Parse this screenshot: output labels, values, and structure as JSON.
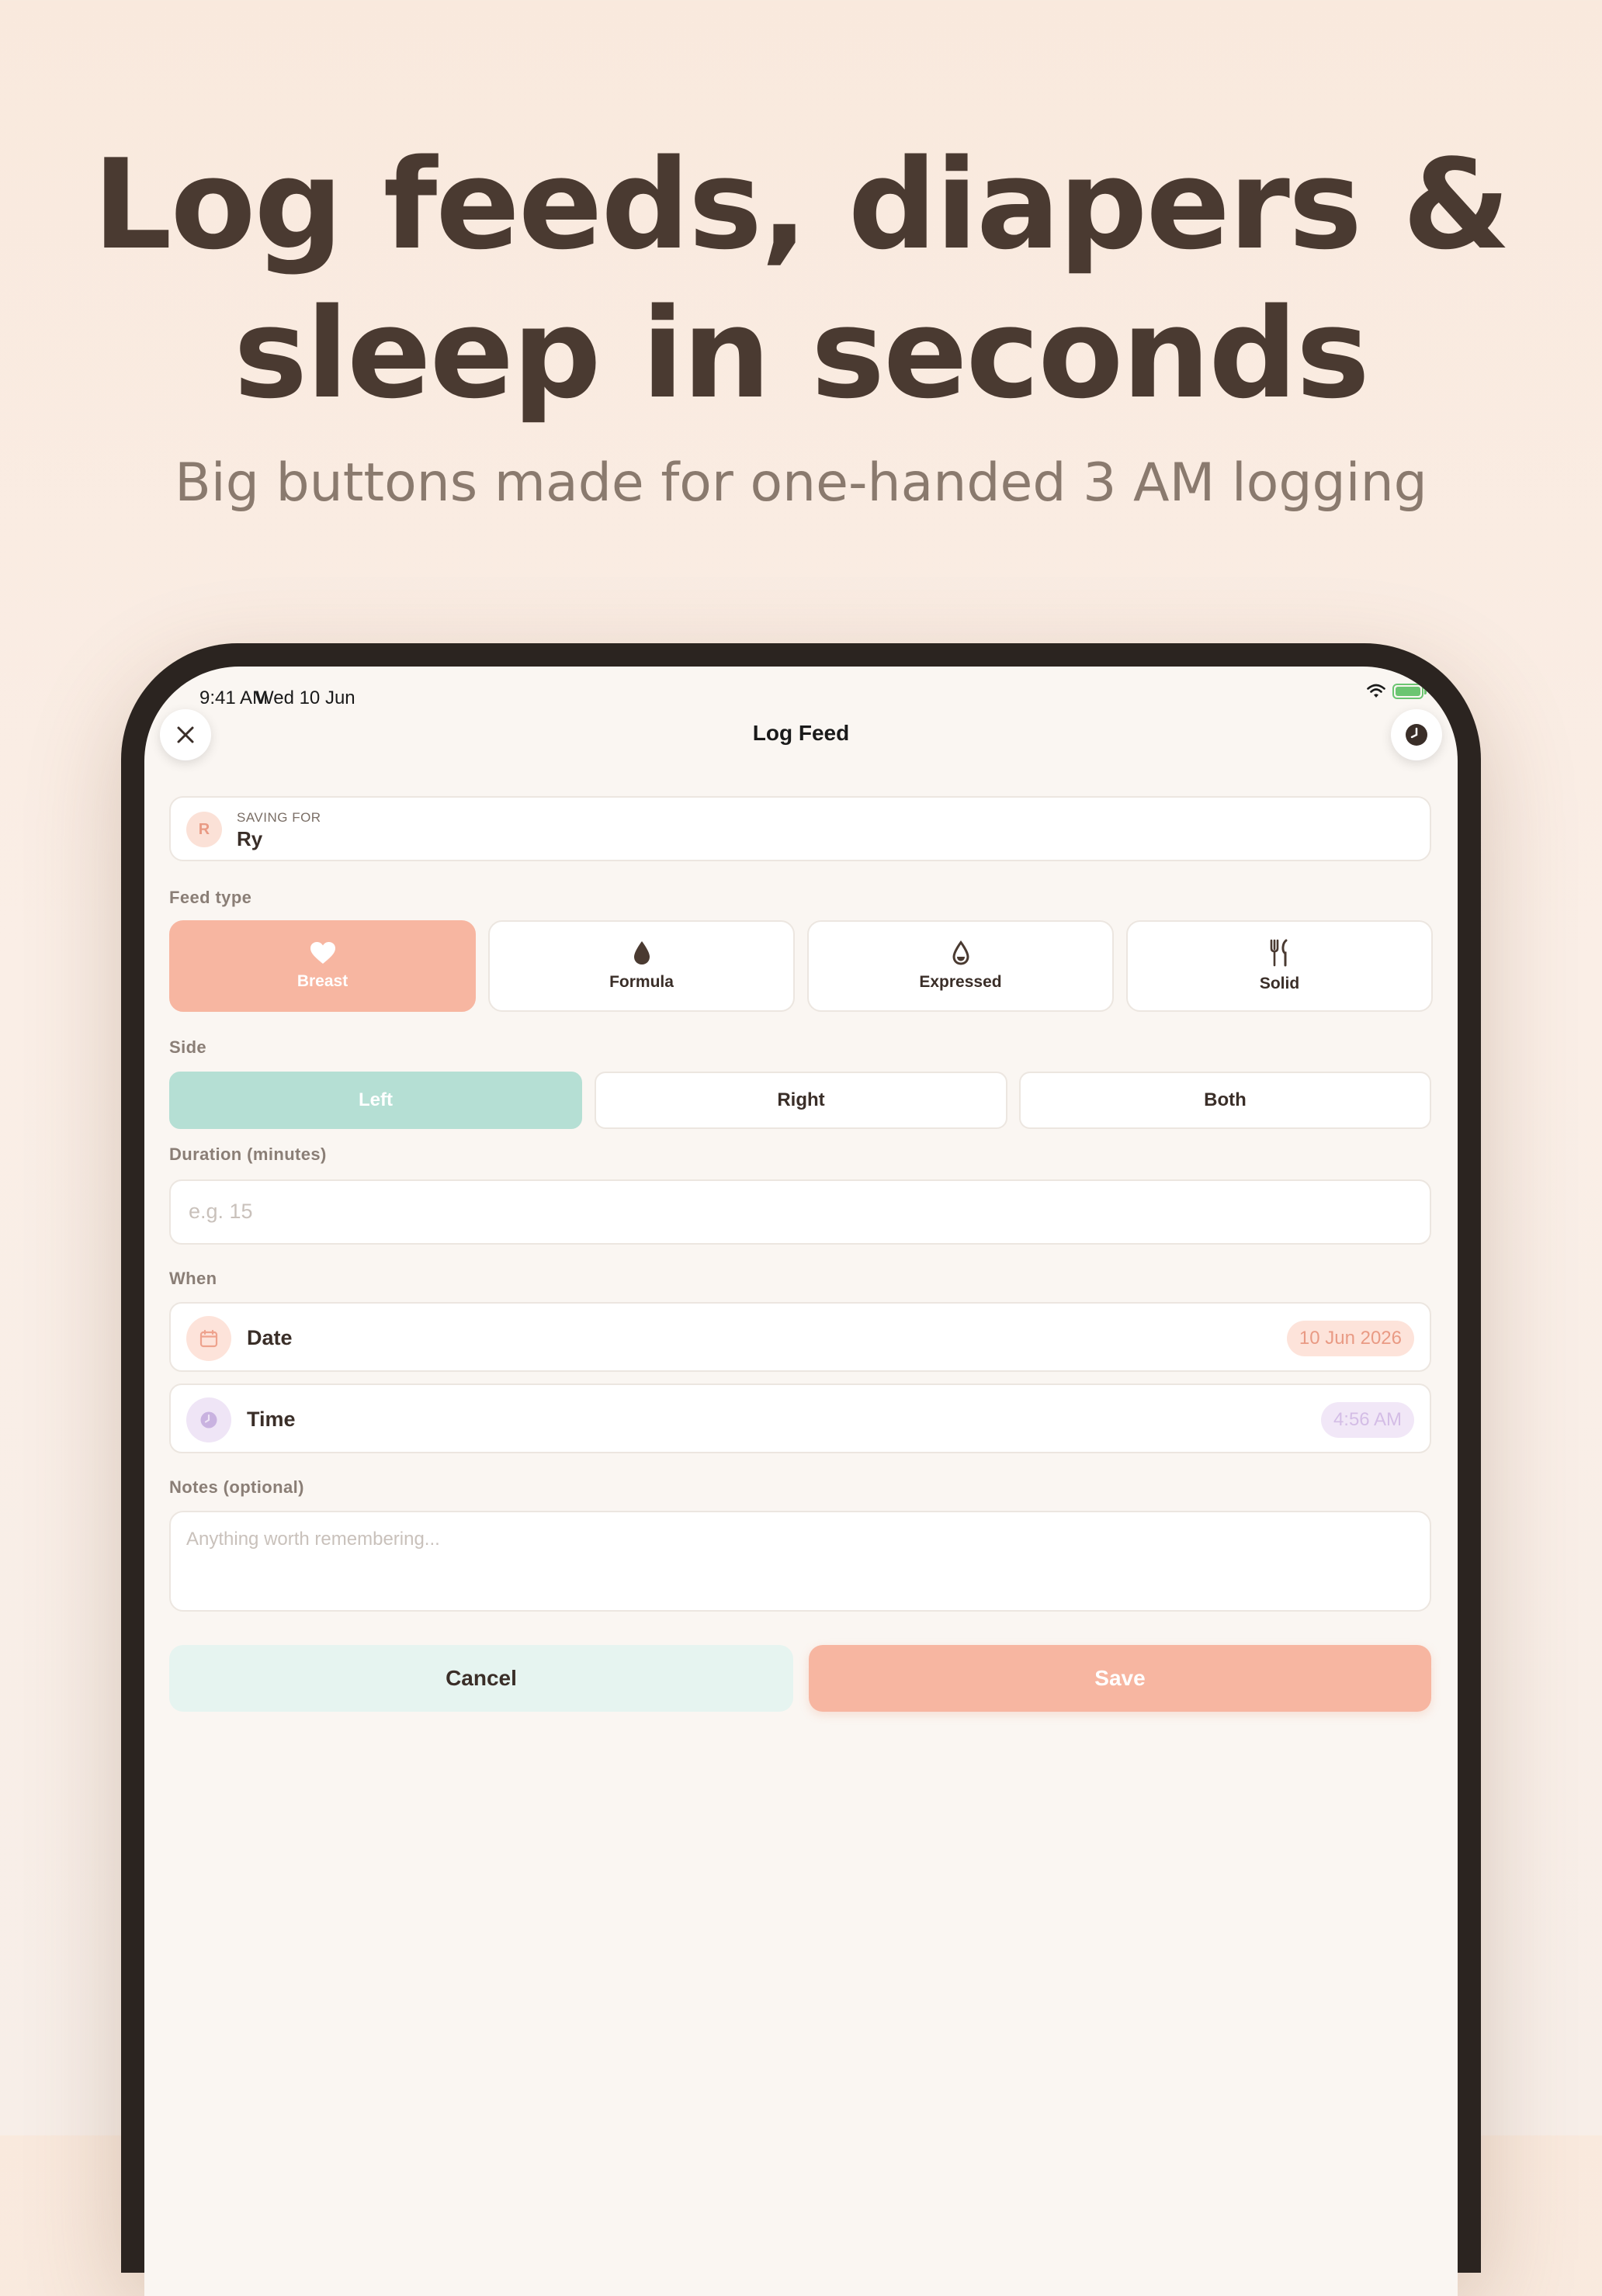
{
  "hero": {
    "headline_line1": "Log feeds, diapers &",
    "headline_line2": "sleep in seconds",
    "subheadline": "Big buttons made for one-handed 3 AM logging"
  },
  "status_bar": {
    "time": "9:41 AM",
    "date": "Wed 10 Jun",
    "icons": [
      "wifi-icon",
      "battery-charging-icon"
    ]
  },
  "nav": {
    "title": "Log Feed",
    "left_icon": "close-icon",
    "right_icon": "clock-icon"
  },
  "saving_for": {
    "avatar_initial": "R",
    "label": "SAVING FOR",
    "name": "Ry"
  },
  "feed_type": {
    "label": "Feed type",
    "options": [
      {
        "label": "Breast",
        "icon": "heart-icon",
        "selected": true
      },
      {
        "label": "Formula",
        "icon": "drop-icon",
        "selected": false
      },
      {
        "label": "Expressed",
        "icon": "drop-outline-icon",
        "selected": false
      },
      {
        "label": "Solid",
        "icon": "fork-knife-icon",
        "selected": false
      }
    ]
  },
  "side": {
    "label": "Side",
    "options": [
      {
        "label": "Left",
        "selected": true
      },
      {
        "label": "Right",
        "selected": false
      },
      {
        "label": "Both",
        "selected": false
      }
    ]
  },
  "duration": {
    "label": "Duration (minutes)",
    "placeholder": "e.g. 15",
    "value": ""
  },
  "when": {
    "label": "When",
    "date_label": "Date",
    "date_value": "10 Jun 2026",
    "time_label": "Time",
    "time_value": "4:56 AM"
  },
  "notes": {
    "label": "Notes (optional)",
    "placeholder": "Anything worth remembering...",
    "value": ""
  },
  "actions": {
    "cancel_label": "Cancel",
    "save_label": "Save"
  },
  "colors": {
    "accent_peach": "#f7b6a1",
    "accent_mint": "#b5dfd4",
    "text_dark": "#3a2e28",
    "headline": "#4a3a31",
    "background": "#faf6f2"
  }
}
